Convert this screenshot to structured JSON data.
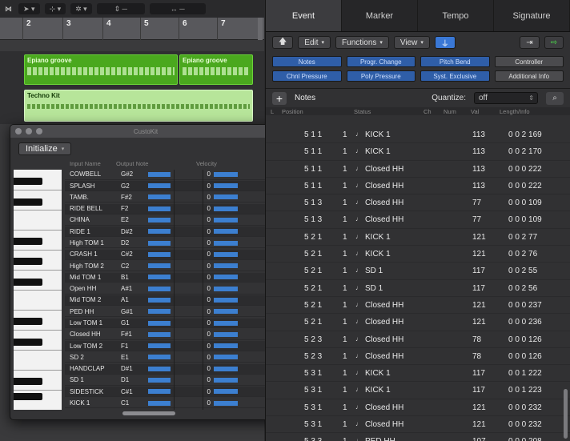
{
  "arrange": {
    "toolbar": {
      "tool1": "➤ ▾",
      "tool2": "⊹ ▾",
      "tool3": "✲ ▾"
    },
    "ruler": [
      "2",
      "3",
      "4",
      "5",
      "6",
      "7"
    ],
    "regions": [
      {
        "name": "Epiano groove"
      },
      {
        "name": "Epiano groove"
      },
      {
        "name": "Techno Kit"
      }
    ]
  },
  "mapping_window": {
    "title": "CustoKit",
    "init_label": "Initialize",
    "columns": {
      "input": "Input Name",
      "output": "Output Note",
      "velocity": "Velocity"
    },
    "rows": [
      {
        "name": "COWBELL",
        "note": "G#2",
        "vel": "0"
      },
      {
        "name": "SPLASH",
        "note": "G2",
        "vel": "0"
      },
      {
        "name": "TAMB.",
        "note": "F#2",
        "vel": "0"
      },
      {
        "name": "RIDE BELL",
        "note": "F2",
        "vel": "0"
      },
      {
        "name": "CHINA",
        "note": "E2",
        "vel": "0"
      },
      {
        "name": "RIDE 1",
        "note": "D#2",
        "vel": "0"
      },
      {
        "name": "High TOM 1",
        "note": "D2",
        "vel": "0"
      },
      {
        "name": "CRASH 1",
        "note": "C#2",
        "vel": "0"
      },
      {
        "name": "High TOM 2",
        "note": "C2",
        "vel": "0"
      },
      {
        "name": "Mid TOM 1",
        "note": "B1",
        "vel": "0"
      },
      {
        "name": "Open HH",
        "note": "A#1",
        "vel": "0"
      },
      {
        "name": "Mid TOM 2",
        "note": "A1",
        "vel": "0"
      },
      {
        "name": "PED HH",
        "note": "G#1",
        "vel": "0"
      },
      {
        "name": "Low TOM 1",
        "note": "G1",
        "vel": "0"
      },
      {
        "name": "Closed HH",
        "note": "F#1",
        "vel": "0"
      },
      {
        "name": "Low TOM 2",
        "note": "F1",
        "vel": "0"
      },
      {
        "name": "SD 2",
        "note": "E1",
        "vel": "0"
      },
      {
        "name": "HANDCLAP",
        "note": "D#1",
        "vel": "0"
      },
      {
        "name": "SD 1",
        "note": "D1",
        "vel": "0"
      },
      {
        "name": "SIDESTICK",
        "note": "C#1",
        "vel": "0"
      },
      {
        "name": "KICK 1",
        "note": "C1",
        "vel": "0"
      }
    ]
  },
  "event_list": {
    "tabs": [
      "Event",
      "Marker",
      "Tempo",
      "Signature"
    ],
    "toolbar": {
      "edit": "Edit",
      "functions": "Functions",
      "view": "View"
    },
    "filters": [
      {
        "label": "Notes",
        "on": true
      },
      {
        "label": "Progr. Change",
        "on": true
      },
      {
        "label": "Pitch Bend",
        "on": true
      },
      {
        "label": "Controller",
        "on": false
      },
      {
        "label": "Chnl Pressure",
        "on": true
      },
      {
        "label": "Poly Pressure",
        "on": true
      },
      {
        "label": "Syst. Exclusive",
        "on": true
      },
      {
        "label": "Additional Info",
        "on": false
      }
    ],
    "create_type": "Notes",
    "quantize_label": "Quantize:",
    "quantize_value": "off",
    "columns": {
      "position": "Position",
      "status": "Status",
      "ch": "Ch",
      "num": "Num",
      "val": "Val",
      "length": "Length/Info"
    },
    "rows": [
      {
        "pos": "5 1 1",
        "sub": "1",
        "name": "KICK 1",
        "val": "113",
        "len": "0 0 2 169"
      },
      {
        "pos": "5 1 1",
        "sub": "1",
        "name": "KICK 1",
        "val": "113",
        "len": "0 0 2 170"
      },
      {
        "pos": "5 1 1",
        "sub": "1",
        "name": "Closed HH",
        "val": "113",
        "len": "0 0 0 222"
      },
      {
        "pos": "5 1 1",
        "sub": "1",
        "name": "Closed HH",
        "val": "113",
        "len": "0 0 0 222"
      },
      {
        "pos": "5 1 3",
        "sub": "1",
        "name": "Closed HH",
        "val": "77",
        "len": "0 0 0 109"
      },
      {
        "pos": "5 1 3",
        "sub": "1",
        "name": "Closed HH",
        "val": "77",
        "len": "0 0 0 109"
      },
      {
        "pos": "5 2 1",
        "sub": "1",
        "name": "KICK 1",
        "val": "121",
        "len": "0 0 2 77"
      },
      {
        "pos": "5 2 1",
        "sub": "1",
        "name": "KICK 1",
        "val": "121",
        "len": "0 0 2 76"
      },
      {
        "pos": "5 2 1",
        "sub": "1",
        "name": "SD 1",
        "val": "117",
        "len": "0 0 2 55"
      },
      {
        "pos": "5 2 1",
        "sub": "1",
        "name": "SD 1",
        "val": "117",
        "len": "0 0 2 56"
      },
      {
        "pos": "5 2 1",
        "sub": "1",
        "name": "Closed HH",
        "val": "121",
        "len": "0 0 0 237"
      },
      {
        "pos": "5 2 1",
        "sub": "1",
        "name": "Closed HH",
        "val": "121",
        "len": "0 0 0 236"
      },
      {
        "pos": "5 2 3",
        "sub": "1",
        "name": "Closed HH",
        "val": "78",
        "len": "0 0 0 126"
      },
      {
        "pos": "5 2 3",
        "sub": "1",
        "name": "Closed HH",
        "val": "78",
        "len": "0 0 0 126"
      },
      {
        "pos": "5 3 1",
        "sub": "1",
        "name": "KICK 1",
        "val": "117",
        "len": "0 0 1 222"
      },
      {
        "pos": "5 3 1",
        "sub": "1",
        "name": "KICK 1",
        "val": "117",
        "len": "0 0 1 223"
      },
      {
        "pos": "5 3 1",
        "sub": "1",
        "name": "Closed HH",
        "val": "121",
        "len": "0 0 0 232"
      },
      {
        "pos": "5 3 1",
        "sub": "1",
        "name": "Closed HH",
        "val": "121",
        "len": "0 0 0 232"
      },
      {
        "pos": "5 3 3",
        "sub": "1",
        "name": "PED HH",
        "val": "107",
        "len": "0 0 0 208"
      }
    ]
  }
}
